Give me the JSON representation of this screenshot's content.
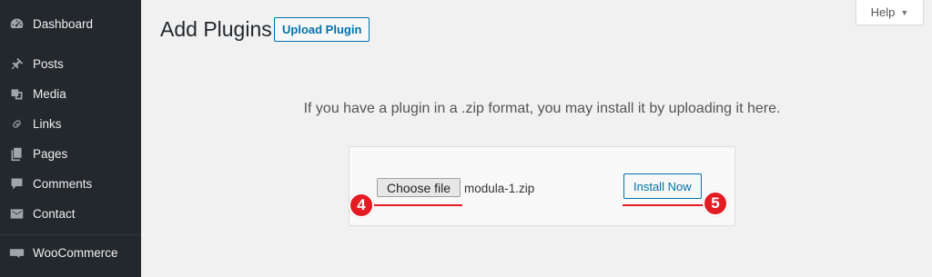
{
  "sidebar": {
    "items": [
      {
        "label": "Dashboard",
        "icon": "dashboard-icon"
      },
      {
        "label": "Posts",
        "icon": "pin-icon"
      },
      {
        "label": "Media",
        "icon": "media-icon"
      },
      {
        "label": "Links",
        "icon": "link-icon"
      },
      {
        "label": "Pages",
        "icon": "pages-icon"
      },
      {
        "label": "Comments",
        "icon": "comment-icon"
      },
      {
        "label": "Contact",
        "icon": "mail-icon"
      },
      {
        "label": "WooCommerce",
        "icon": "woo-icon"
      }
    ],
    "background": "#23282d"
  },
  "help": {
    "label": "Help",
    "caret": "▼"
  },
  "header": {
    "title": "Add Plugins",
    "upload_button": "Upload Plugin"
  },
  "upload": {
    "description": "If you have a plugin in a .zip format, you may install it by uploading it here.",
    "choose_label": "Choose file",
    "file_name": "modula-1.zip",
    "install_label": "Install Now"
  },
  "annotations": {
    "step_choose": "4",
    "step_install": "5",
    "color": "#e31b23"
  },
  "accent_color": "#0073aa"
}
